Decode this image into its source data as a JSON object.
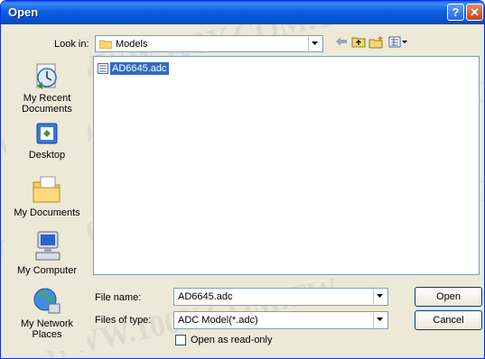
{
  "window": {
    "title": "Open",
    "help_glyph": "?",
    "close_glyph": "✕"
  },
  "lookin": {
    "label": "Look in:",
    "value": "Models"
  },
  "places": [
    {
      "label": "My Recent Documents",
      "icon": "recent-documents-icon"
    },
    {
      "label": "Desktop",
      "icon": "desktop-icon"
    },
    {
      "label": "My Documents",
      "icon": "my-documents-icon"
    },
    {
      "label": "My Computer",
      "icon": "my-computer-icon"
    },
    {
      "label": "My Network Places",
      "icon": "network-places-icon"
    }
  ],
  "files": [
    {
      "name": "AD6645.adc",
      "selected": true
    }
  ],
  "filename": {
    "label": "File name:",
    "value": "AD6645.adc"
  },
  "filetype": {
    "label": "Files of type:",
    "value": "ADC Model(*.adc)"
  },
  "readonly": {
    "label": "Open as read-only",
    "checked": false
  },
  "buttons": {
    "open": "Open",
    "cancel": "Cancel"
  },
  "watermark": "WWW.100Y.COM.TW"
}
